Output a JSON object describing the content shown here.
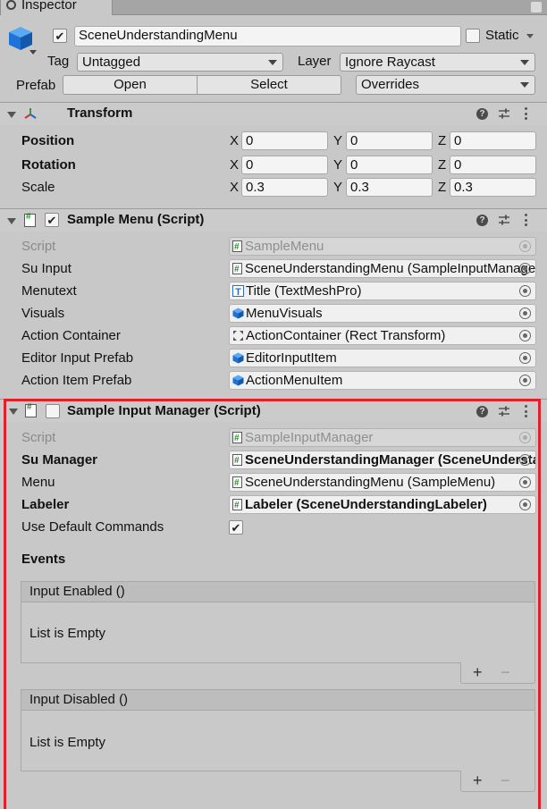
{
  "window": {
    "tab_label": "Inspector"
  },
  "gameobject": {
    "active": true,
    "name": "SceneUnderstandingMenu",
    "static_label": "Static",
    "tag_label": "Tag",
    "tag_value": "Untagged",
    "layer_label": "Layer",
    "layer_value": "Ignore Raycast",
    "prefab_label": "Prefab",
    "open_label": "Open",
    "select_label": "Select",
    "overrides_label": "Overrides"
  },
  "transform": {
    "title": "Transform",
    "rows": [
      {
        "label": "Position",
        "x": "0",
        "y": "0",
        "z": "0"
      },
      {
        "label": "Rotation",
        "x": "0",
        "y": "0",
        "z": "0"
      },
      {
        "label": "Scale",
        "x": "0.3",
        "y": "0.3",
        "z": "0.3"
      }
    ],
    "axis": {
      "x": "X",
      "y": "Y",
      "z": "Z"
    }
  },
  "sample_menu": {
    "title": "Sample Menu (Script)",
    "enabled": true,
    "fields": [
      {
        "label": "Script",
        "value": "SampleMenu",
        "icon": "script-icon"
      },
      {
        "label": "Su Input",
        "value": "SceneUnderstandingMenu (SampleInputManager)",
        "icon": "script-icon"
      },
      {
        "label": "Menutext",
        "value": "Title (TextMeshPro)",
        "icon": "textmeshpro-icon"
      },
      {
        "label": "Visuals",
        "value": "MenuVisuals",
        "icon": "cube-icon"
      },
      {
        "label": "Action Container",
        "value": "ActionContainer (Rect Transform)",
        "icon": "rect-transform-icon"
      },
      {
        "label": "Editor Input Prefab",
        "value": "EditorInputItem",
        "icon": "cube-icon"
      },
      {
        "label": "Action Item Prefab",
        "value": "ActionMenuItem",
        "icon": "cube-icon"
      }
    ]
  },
  "sample_input_manager": {
    "title": "Sample Input Manager (Script)",
    "enabled": false,
    "fields": [
      {
        "label": "Script",
        "value": "SampleInputManager",
        "icon": "script-icon"
      },
      {
        "label": "Su Manager",
        "value": "SceneUnderstandingManager (SceneUnderstandingManager)",
        "icon": "script-icon"
      },
      {
        "label": "Menu",
        "value": "SceneUnderstandingMenu (SampleMenu)",
        "icon": "script-icon"
      },
      {
        "label": "Labeler",
        "value": "Labeler (SceneUnderstandingLabeler)",
        "icon": "script-icon"
      }
    ],
    "use_default_commands_label": "Use Default Commands",
    "use_default_commands": true,
    "events_label": "Events",
    "events": [
      {
        "header": "Input Enabled ()",
        "empty_text": "List is Empty"
      },
      {
        "header": "Input Disabled ()",
        "empty_text": "List is Empty"
      }
    ],
    "plus": "+",
    "minus": "−"
  },
  "colors": {
    "highlight": "#e0202a",
    "panel": "#c8c8c8",
    "cube_blue": "#1e74d6"
  }
}
